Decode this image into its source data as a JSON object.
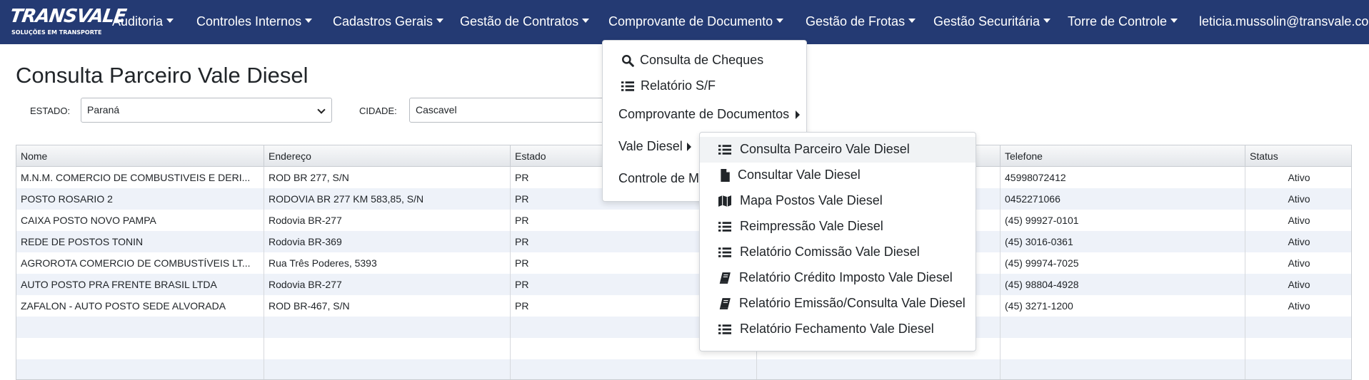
{
  "navbar": {
    "logo_text": "TRANSVALE",
    "logo_tagline": "SOLUÇÕES EM TRANSPORTE",
    "items": [
      {
        "label": "Auditoria"
      },
      {
        "label": "Controles Internos"
      },
      {
        "label": "Cadastros Gerais"
      },
      {
        "label": "Gestão de Contratos"
      },
      {
        "label": "Comprovante de Documento"
      },
      {
        "label": "Gestão de Frotas"
      },
      {
        "label": "Gestão Securitária"
      },
      {
        "label": "Torre de Controle"
      }
    ],
    "user": "leticia.mussolin@transvale.com",
    "bg_color": "#243a73"
  },
  "page": {
    "title": "Consulta Parceiro Vale Diesel"
  },
  "filters": {
    "estado_label": "ESTADO:",
    "estado_value": "Paraná",
    "cidade_label": "CIDADE:",
    "cidade_value": "Cascavel"
  },
  "table": {
    "columns": [
      "Nome",
      "Endereço",
      "Estado",
      "",
      "Telefone",
      "Status"
    ],
    "rows": [
      {
        "nome": "M.N.M. COMERCIO DE COMBUSTIVEIS E DERI...",
        "endereco": "ROD BR 277, S/N",
        "estado": "PR",
        "telefone": "45998072412",
        "status": "Ativo"
      },
      {
        "nome": "POSTO ROSARIO 2",
        "endereco": "RODOVIA BR 277 KM 583,85, S/N",
        "estado": "PR",
        "telefone": "0452271066",
        "status": "Ativo"
      },
      {
        "nome": "CAIXA POSTO NOVO PAMPA",
        "endereco": "Rodovia BR-277",
        "estado": "PR",
        "telefone": "(45) 99927-0101",
        "status": "Ativo"
      },
      {
        "nome": "REDE DE POSTOS TONIN",
        "endereco": "Rodovia BR-369",
        "estado": "PR",
        "telefone": "(45) 3016-0361",
        "status": "Ativo"
      },
      {
        "nome": "AGROROTA COMERCIO DE COMBUSTÍVEIS LT...",
        "endereco": "Rua Três Poderes, 5393",
        "estado": "PR",
        "telefone": "(45) 99974-7025",
        "status": "Ativo"
      },
      {
        "nome": "AUTO POSTO PRA FRENTE BRASIL LTDA",
        "endereco": "Rodovia BR-277",
        "estado": "PR",
        "telefone": "(45) 98804-4928",
        "status": "Ativo"
      },
      {
        "nome": "ZAFALON - AUTO POSTO SEDE ALVORADA",
        "endereco": "ROD BR-467, S/N",
        "estado": "PR",
        "telefone": "(45) 3271-1200",
        "status": "Ativo"
      }
    ]
  },
  "dropdown": {
    "items": [
      {
        "label": "Consulta de Cheques",
        "icon": "search-icon"
      },
      {
        "label": "Relatório S/F",
        "icon": "list-icon"
      },
      {
        "label": "Comprovante de Documentos",
        "icon": "caret-right-icon"
      },
      {
        "label": "Vale Diesel",
        "icon": "caret-right-icon"
      },
      {
        "label": "Controle de M",
        "icon": ""
      }
    ]
  },
  "submenu": {
    "items": [
      {
        "label": "Consulta Parceiro Vale Diesel",
        "icon": "list-icon"
      },
      {
        "label": "Consultar Vale Diesel",
        "icon": "file-icon"
      },
      {
        "label": "Mapa Postos Vale Diesel",
        "icon": "map-icon"
      },
      {
        "label": "Reimpressão Vale Diesel",
        "icon": "list-icon"
      },
      {
        "label": "Relatório Comissão Vale Diesel",
        "icon": "list-icon"
      },
      {
        "label": "Relatório Crédito Imposto Vale Diesel",
        "icon": "book-icon"
      },
      {
        "label": "Relatório Emissão/Consulta Vale Diesel",
        "icon": "book-icon"
      },
      {
        "label": "Relatório Fechamento Vale Diesel",
        "icon": "list-icon"
      }
    ]
  }
}
